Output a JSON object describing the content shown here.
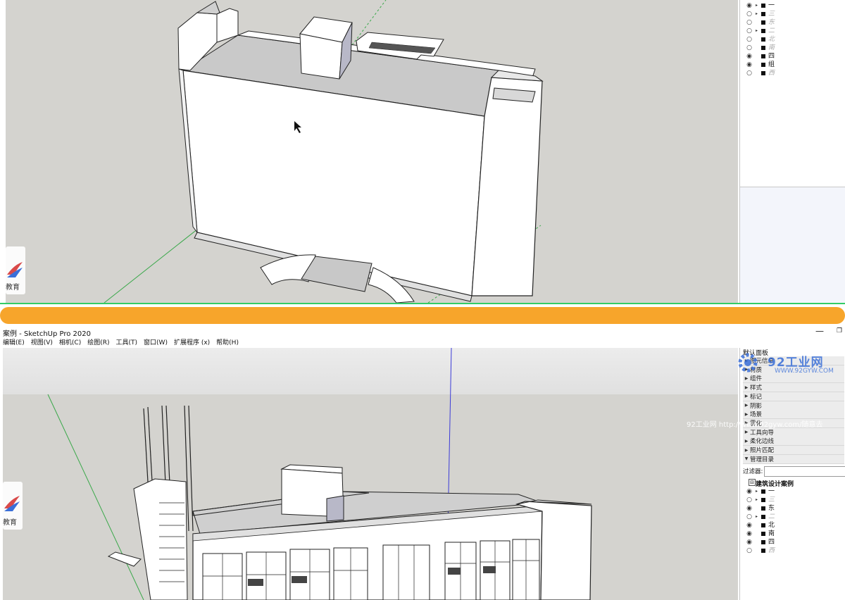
{
  "top_tray": {
    "tags": [
      {
        "label": "一",
        "visible": true,
        "expand": true,
        "dim": false
      },
      {
        "label": "三",
        "visible": false,
        "expand": true,
        "dim": true
      },
      {
        "label": "东",
        "visible": false,
        "expand": false,
        "dim": true
      },
      {
        "label": "二",
        "visible": false,
        "expand": true,
        "dim": true
      },
      {
        "label": "北",
        "visible": false,
        "expand": false,
        "dim": true
      },
      {
        "label": "南",
        "visible": false,
        "expand": false,
        "dim": true
      },
      {
        "label": "四",
        "visible": true,
        "expand": false,
        "dim": false
      },
      {
        "label": "组",
        "visible": true,
        "expand": false,
        "dim": false
      },
      {
        "label": "西",
        "visible": false,
        "expand": false,
        "dim": true
      }
    ]
  },
  "window": {
    "title": "案例 - SketchUp Pro 2020",
    "minimize_glyph": "—",
    "maximize_glyph": "❐"
  },
  "menu": [
    "编辑(E)",
    "视图(V)",
    "相机(C)",
    "绘图(R)",
    "工具(T)",
    "窗口(W)",
    "扩展程序 (x)",
    "帮助(H)"
  ],
  "tray": {
    "title": "默认面板",
    "panels": [
      "图元信息",
      "材质",
      "组件",
      "样式",
      "标记",
      "阴影",
      "场景",
      "雾化",
      "工具向导",
      "柔化边线",
      "照片匹配",
      "管理目录"
    ],
    "filter_label": "过滤器:",
    "filter_value": "",
    "outliner_root": "建筑设计案例",
    "outliner_items": [
      {
        "label": "一",
        "visible": true,
        "expand": true,
        "dim": false
      },
      {
        "label": "三",
        "visible": false,
        "expand": true,
        "dim": true
      },
      {
        "label": "东",
        "visible": true,
        "expand": false,
        "dim": false
      },
      {
        "label": "二",
        "visible": false,
        "expand": true,
        "dim": true
      },
      {
        "label": "北",
        "visible": true,
        "expand": false,
        "dim": false
      },
      {
        "label": "南",
        "visible": true,
        "expand": false,
        "dim": false
      },
      {
        "label": "四",
        "visible": true,
        "expand": false,
        "dim": false
      },
      {
        "label": "西",
        "visible": false,
        "expand": false,
        "dim": true
      }
    ]
  },
  "watermarks": {
    "logo_text": "教育",
    "site_name": "92工业网",
    "site_url": "WWW.92GYW.COM",
    "overlay_line": "92工业网 http://www.92gyw.com/随意去"
  },
  "icons": {
    "eye_visible": "eye-icon",
    "eye_hidden": "eye-hidden-icon",
    "expand": "triangle-right-icon",
    "collapse": "triangle-down-icon"
  }
}
